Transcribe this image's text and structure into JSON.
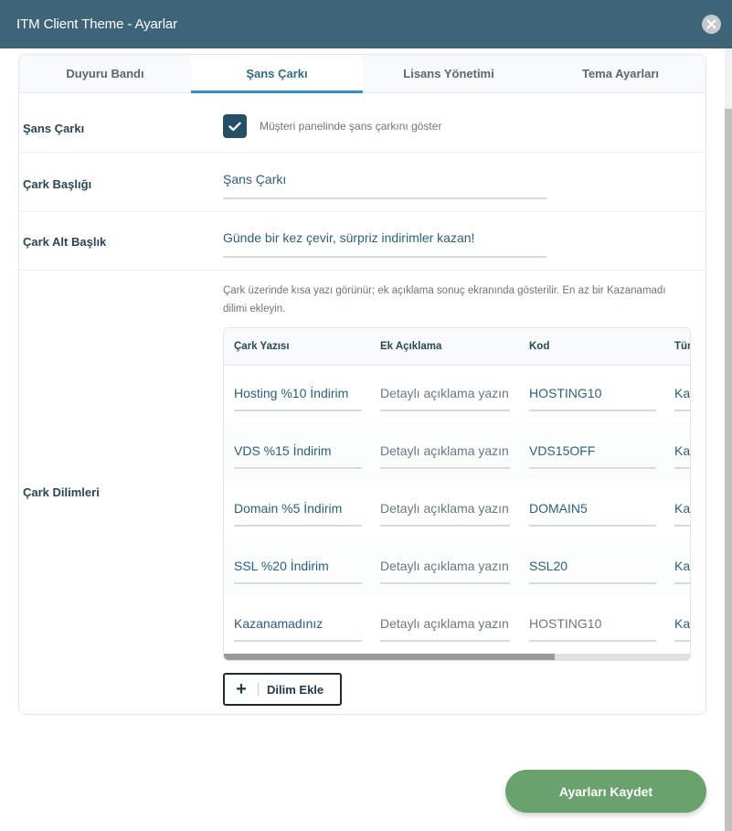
{
  "window": {
    "title": "ITM Client Theme - Ayarlar"
  },
  "tabs": [
    {
      "label": "Duyuru Bandı",
      "active": false
    },
    {
      "label": "Şans Çarkı",
      "active": true
    },
    {
      "label": "Lisans Yönetimi",
      "active": false
    },
    {
      "label": "Tema Ayarları",
      "active": false
    }
  ],
  "form": {
    "enable": {
      "label": "Şans Çarkı",
      "checked": true,
      "text": "Müşteri panelinde şans çarkını göster"
    },
    "title": {
      "label": "Çark Başlığı",
      "value": "Şans Çarkı"
    },
    "subtitle": {
      "label": "Çark Alt Başlık",
      "value": "Günde bir kez çevir, sürpriz indirimler kazan!"
    },
    "slices": {
      "label": "Çark Dilimleri",
      "hint": "Çark üzerinde kısa yazı görünür; ek açıklama sonuç ekranında gösterilir. En az bir Kazanamadı dilimi ekleyin.",
      "columns": [
        "Çark Yazısı",
        "Ek Açıklama",
        "Kod",
        "Tür"
      ],
      "rows": [
        {
          "text": "Hosting %10 İndirim",
          "desc_placeholder": "Detaylı açıklama yazın",
          "code": "HOSTING10",
          "type": "Kazanç"
        },
        {
          "text": "VDS %15 İndirim",
          "desc_placeholder": "Detaylı açıklama yazın",
          "code": "VDS15OFF",
          "type": "Kazanç"
        },
        {
          "text": "Domain %5 İndirim",
          "desc_placeholder": "Detaylı açıklama yazın",
          "code": "DOMAIN5",
          "type": "Kazanç"
        },
        {
          "text": "SSL %20 İndirim",
          "desc_placeholder": "Detaylı açıklama yazın",
          "code": "SSL20",
          "type": "Kazanç"
        },
        {
          "text": "Kazanamadınız",
          "desc_placeholder": "Detaylı açıklama yazın",
          "code_placeholder": "HOSTING10",
          "type": "Kazanamadı"
        }
      ],
      "add_label": "Dilim Ekle"
    }
  },
  "actions": {
    "save_label": "Ayarları Kaydet"
  },
  "colors": {
    "header": "#3e6478",
    "accent": "#2f8fc6",
    "save": "#6aa26d",
    "checkbox": "#244f66"
  }
}
